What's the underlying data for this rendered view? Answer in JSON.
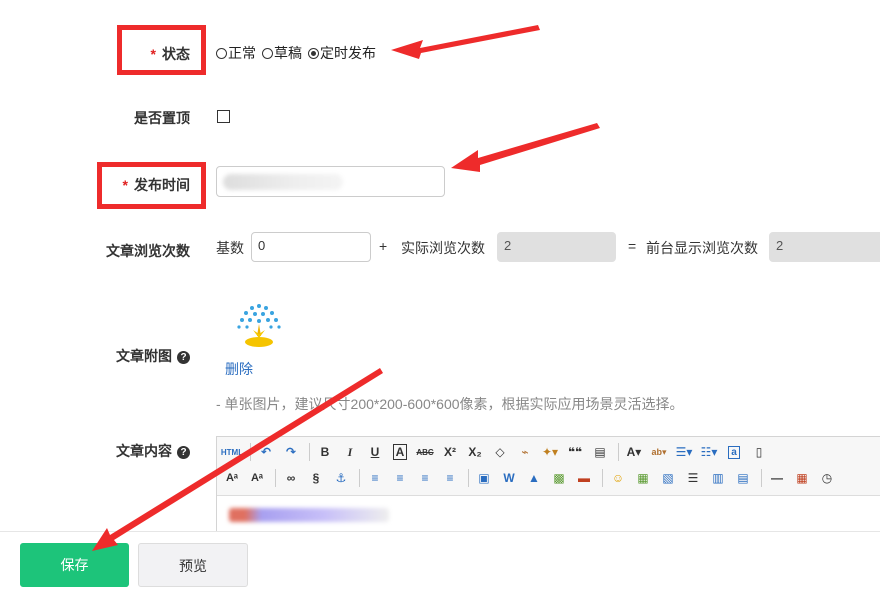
{
  "form": {
    "status_label": "状态",
    "status_options": [
      "正常",
      "草稿",
      "定时发布"
    ],
    "status_selected": "定时发布",
    "pin_label": "是否置顶",
    "publish_time_label": "发布时间",
    "views_label": "文章浏览次数",
    "base_label": "基数",
    "base_value": "0",
    "plus": "+",
    "actual_label": "实际浏览次数",
    "actual_value": "2",
    "equals": "=",
    "display_label": "前台显示浏览次数",
    "display_value": "2",
    "image_label": "文章附图",
    "delete_link": "删除",
    "image_hint": "- 单张图片，建议尺寸200*200-600*600像素，根据实际应用场景灵活选择。",
    "content_label": "文章内容"
  },
  "editor": {
    "row1": [
      "HTML",
      "undo",
      "redo",
      "B",
      "I",
      "U",
      "A",
      "ABC",
      "X²",
      "X₂",
      "eraser",
      "brush",
      "wand",
      "❝❝",
      "paste",
      "A",
      "ab",
      "ol",
      "ul",
      "a",
      "page"
    ],
    "row2": [
      "Aa",
      "Aa",
      "link",
      "unlink",
      "anchor",
      "left",
      "center",
      "right",
      "justify",
      "video",
      "W",
      "img",
      "imgs",
      "pic",
      "smile",
      "map",
      "grid",
      "table",
      "rows",
      "cols",
      "hr",
      "date",
      "time"
    ]
  },
  "actions": {
    "save_label": "保存",
    "preview_label": "预览"
  },
  "colors": {
    "required": "#e02020",
    "annotation": "#ee2b2b",
    "save_bg": "#1dc47a",
    "link": "#2a6dc0"
  }
}
